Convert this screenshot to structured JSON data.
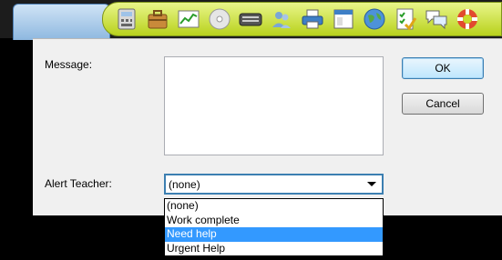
{
  "toolbar": {
    "icons": [
      "calculator-icon",
      "briefcase-icon",
      "chart-icon",
      "cd-icon",
      "keyboard-icon",
      "users-icon",
      "printer-icon",
      "window-icon",
      "globe-icon",
      "checklist-icon",
      "chat-icon",
      "lifebuoy-icon"
    ]
  },
  "dialog": {
    "message_label": "Message:",
    "alert_label": "Alert Teacher:",
    "ok_label": "OK",
    "cancel_label": "Cancel",
    "select_value": "(none)",
    "options": [
      "(none)",
      "Work complete",
      "Need help",
      "Urgent Help"
    ],
    "highlighted_option": "Need help"
  },
  "colors": {
    "accent": "#3399ff",
    "toolbar_green": "#c8dc2c",
    "tab_blue": "#8eb8e0"
  }
}
